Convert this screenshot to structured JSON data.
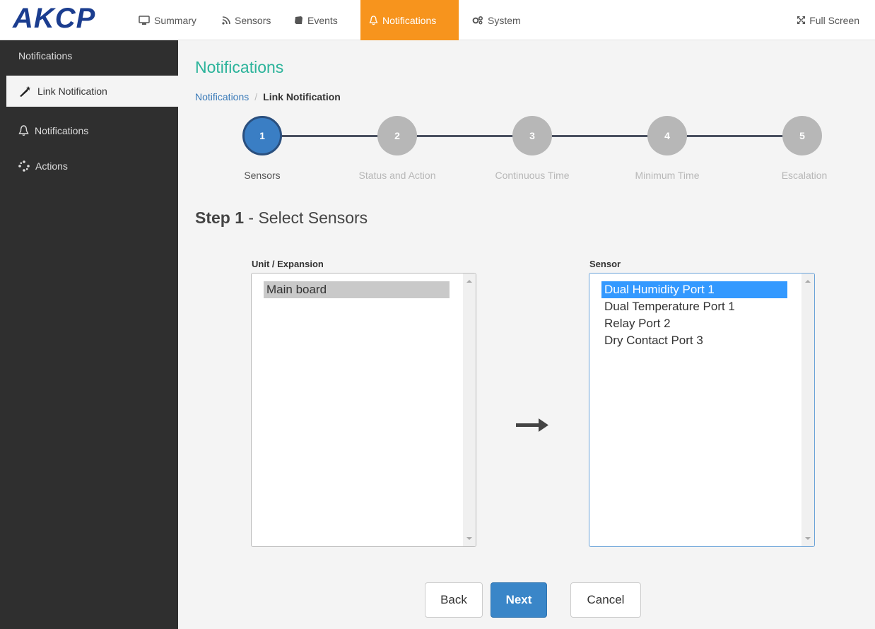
{
  "brand": {
    "logo_text": "AKCP",
    "logo_color": "#1b3d8f"
  },
  "topnav": {
    "items": [
      {
        "label": "Summary",
        "icon": "monitor-icon"
      },
      {
        "label": "Sensors",
        "icon": "rss-icon"
      },
      {
        "label": "Events",
        "icon": "book-icon"
      },
      {
        "label": "Notifications",
        "icon": "bell-icon",
        "active": true
      },
      {
        "label": "System",
        "icon": "gears-icon"
      }
    ],
    "fullscreen_label": "Full Screen",
    "active_color": "#f7941d"
  },
  "sidebar": {
    "heading": "Notifications",
    "items": [
      {
        "label": "Link Notification",
        "icon": "magic-wand-icon",
        "active": true
      },
      {
        "label": "Notifications",
        "icon": "bell-icon"
      },
      {
        "label": "Actions",
        "icon": "spinner-icon"
      }
    ]
  },
  "main": {
    "title": "Notifications",
    "breadcrumb": {
      "parent": "Notifications",
      "separator": "/",
      "current": "Link Notification"
    },
    "steps": [
      {
        "number": "1",
        "label": "Sensors",
        "active": true
      },
      {
        "number": "2",
        "label": "Status and Action"
      },
      {
        "number": "3",
        "label": "Continuous Time"
      },
      {
        "number": "4",
        "label": "Minimum Time"
      },
      {
        "number": "5",
        "label": "Escalation"
      }
    ],
    "step_heading": {
      "prefix": "Step 1",
      "text": " - Select Sensors"
    },
    "unit_box": {
      "label": "Unit / Expansion",
      "options": [
        "Main board"
      ],
      "selected": "Main board"
    },
    "sensor_box": {
      "label": "Sensor",
      "options": [
        "Dual Humidity Port 1",
        "Dual Temperature Port 1",
        "Relay Port 2",
        "Dry Contact Port 3"
      ],
      "selected": "Dual Humidity Port 1"
    },
    "buttons": {
      "back": "Back",
      "next": "Next",
      "cancel": "Cancel"
    }
  }
}
